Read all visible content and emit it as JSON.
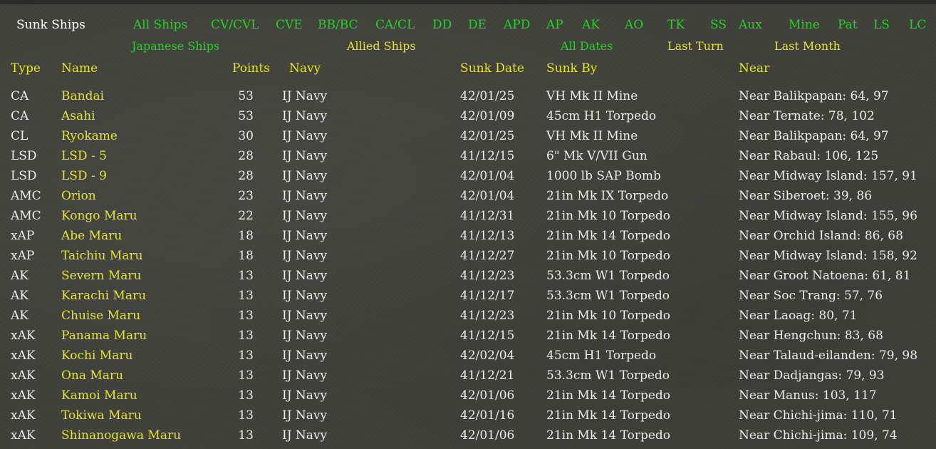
{
  "title": "Sunk Ships",
  "filters": [
    "All Ships",
    "CV/CVL",
    "CVE",
    "BB/BC",
    "CA/CL",
    "DD",
    "DE",
    "APD",
    "AP",
    "AK",
    "AO",
    "TK",
    "SS",
    "Aux",
    "Mine",
    "Pat",
    "LS",
    "LC"
  ],
  "options": [
    "Japanese Ships",
    "Allied Ships",
    "All Dates",
    "Last Turn",
    "Last Month"
  ],
  "columns": {
    "type": "Type",
    "name": "Name",
    "points": "Points",
    "navy": "Navy",
    "sunk_date": "Sunk Date",
    "sunk_by": "Sunk By",
    "near": "Near"
  },
  "colors": {
    "filter": "#22d422",
    "option": "#e8e32c",
    "text": "#ececec",
    "title": "#ffffff",
    "background": "#3f413a"
  },
  "rows": [
    {
      "type": "CA",
      "name": "Bandai",
      "points": "53",
      "navy": "IJ Navy",
      "date": "42/01/25",
      "by": "VH Mk II Mine",
      "near": "Near Balikpapan: 64, 97"
    },
    {
      "type": "CA",
      "name": "Asahi",
      "points": "53",
      "navy": "IJ Navy",
      "date": "42/01/09",
      "by": "45cm H1 Torpedo",
      "near": "Near Ternate: 78, 102"
    },
    {
      "type": "CL",
      "name": "Ryokame",
      "points": "30",
      "navy": "IJ Navy",
      "date": "42/01/25",
      "by": "VH Mk II Mine",
      "near": "Near Balikpapan: 64, 97"
    },
    {
      "type": "LSD",
      "name": "LSD - 5",
      "points": "28",
      "navy": "IJ Navy",
      "date": "41/12/15",
      "by": "6\" Mk V/VII Gun",
      "near": "Near Rabaul: 106, 125"
    },
    {
      "type": "LSD",
      "name": "LSD - 9",
      "points": "28",
      "navy": "IJ Navy",
      "date": "42/01/04",
      "by": "1000 lb SAP Bomb",
      "near": "Near Midway Island: 157, 91"
    },
    {
      "type": "AMC",
      "name": "Orion",
      "points": "23",
      "navy": "IJ Navy",
      "date": "42/01/04",
      "by": "21in Mk IX Torpedo",
      "near": "Near Siberoet: 39, 86"
    },
    {
      "type": "AMC",
      "name": "Kongo Maru",
      "points": "22",
      "navy": "IJ Navy",
      "date": "41/12/31",
      "by": "21in Mk 10 Torpedo",
      "near": "Near Midway Island: 155, 96"
    },
    {
      "type": "xAP",
      "name": "Abe Maru",
      "points": "18",
      "navy": "IJ Navy",
      "date": "41/12/13",
      "by": "21in Mk 14 Torpedo",
      "near": "Near Orchid Island: 86, 68"
    },
    {
      "type": "xAP",
      "name": "Taichiu Maru",
      "points": "18",
      "navy": "IJ Navy",
      "date": "41/12/27",
      "by": "21in Mk 10 Torpedo",
      "near": "Near Midway Island: 158, 92"
    },
    {
      "type": "AK",
      "name": "Severn Maru",
      "points": "13",
      "navy": "IJ Navy",
      "date": "41/12/23",
      "by": "53.3cm W1 Torpedo",
      "near": "Near Groot Natoena: 61, 81"
    },
    {
      "type": "AK",
      "name": "Karachi Maru",
      "points": "13",
      "navy": "IJ Navy",
      "date": "41/12/17",
      "by": "53.3cm W1 Torpedo",
      "near": "Near Soc Trang: 57, 76"
    },
    {
      "type": "AK",
      "name": "Chuise Maru",
      "points": "13",
      "navy": "IJ Navy",
      "date": "41/12/23",
      "by": "21in Mk 10 Torpedo",
      "near": "Near Laoag: 80, 71"
    },
    {
      "type": "xAK",
      "name": "Panama Maru",
      "points": "13",
      "navy": "IJ Navy",
      "date": "41/12/15",
      "by": "21in Mk 14 Torpedo",
      "near": "Near Hengchun: 83, 68"
    },
    {
      "type": "xAK",
      "name": "Kochi Maru",
      "points": "13",
      "navy": "IJ Navy",
      "date": "42/02/04",
      "by": "45cm H1 Torpedo",
      "near": "Near Talaud-eilanden: 79, 98"
    },
    {
      "type": "xAK",
      "name": "Ona Maru",
      "points": "13",
      "navy": "IJ Navy",
      "date": "41/12/21",
      "by": "53.3cm W1 Torpedo",
      "near": "Near Dadjangas: 79, 93"
    },
    {
      "type": "xAK",
      "name": "Kamoi Maru",
      "points": "13",
      "navy": "IJ Navy",
      "date": "42/01/06",
      "by": "21in Mk 14 Torpedo",
      "near": "Near Manus: 103, 117"
    },
    {
      "type": "xAK",
      "name": "Tokiwa Maru",
      "points": "13",
      "navy": "IJ Navy",
      "date": "42/01/16",
      "by": "21in Mk 14 Torpedo",
      "near": "Near Chichi-jima: 110, 71"
    },
    {
      "type": "xAK",
      "name": "Shinanogawa Maru",
      "points": "13",
      "navy": "IJ Navy",
      "date": "42/01/06",
      "by": "21in Mk 14 Torpedo",
      "near": "Near Chichi-jima: 109, 74"
    }
  ]
}
